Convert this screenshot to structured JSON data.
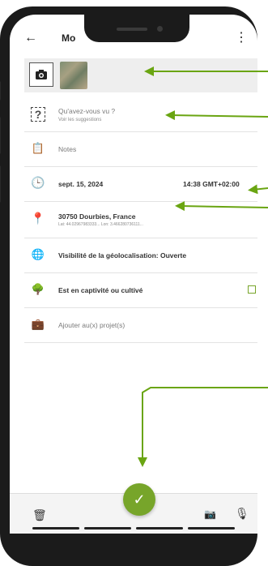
{
  "appbar": {
    "back_icon": "←",
    "title": "Mo",
    "menu_icon": "⋮"
  },
  "photos": {
    "add_photo_icon": "camera-plus-icon"
  },
  "rows": {
    "species": {
      "label": "Qu'avez-vous vu ?",
      "sub": "Voir les suggestions",
      "icon": "?"
    },
    "notes": {
      "label": "Notes",
      "icon": "📋"
    },
    "date": {
      "label": "sept. 15, 2024",
      "time": "14:38 GMT+02:00",
      "icon": "🕒"
    },
    "location": {
      "label": "30750 Dourbies, France",
      "sub": "Lat: 44.02967983333... Lon: 3.466280736111...",
      "icon": "📍"
    },
    "geo": {
      "label": "Visibilité de la géolocalisation: Ouverte",
      "icon": "🌐"
    },
    "captive": {
      "label": "Est en captivité ou cultivé",
      "icon": "🌳"
    },
    "projects": {
      "label": "Ajouter au(x) projet(s)",
      "icon": "💼"
    }
  },
  "bottom": {
    "trash_icon": "🗑",
    "camera_icon": "📷",
    "mic_icon": "🎙",
    "fab_icon": "✓"
  },
  "colors": {
    "accent": "#77a52a"
  }
}
